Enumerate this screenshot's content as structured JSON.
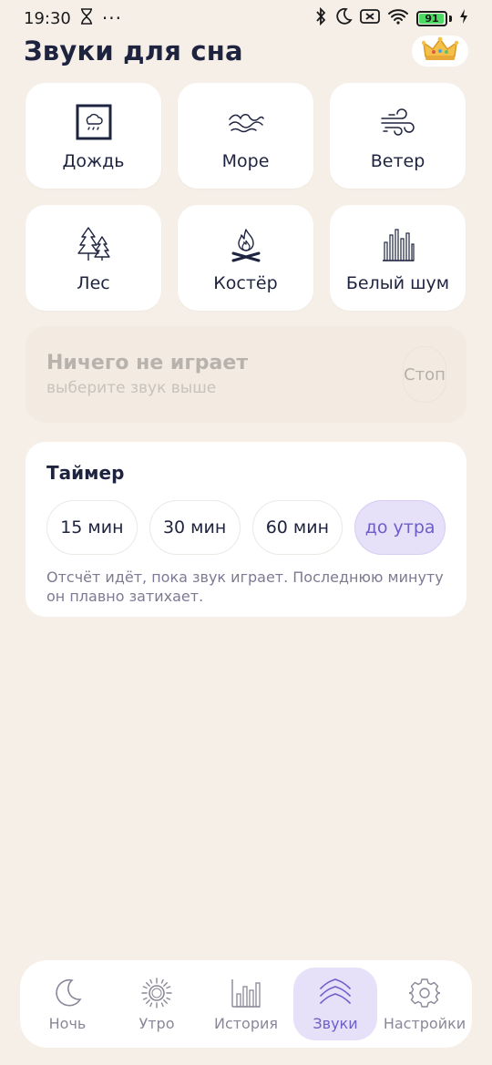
{
  "status_bar": {
    "time": "19:30",
    "dots": "···",
    "battery": "91"
  },
  "header": {
    "title": "Звуки для сна"
  },
  "sounds": [
    {
      "label": "Дождь",
      "icon": "rain-icon"
    },
    {
      "label": "Море",
      "icon": "waves-icon"
    },
    {
      "label": "Ветер",
      "icon": "wind-icon"
    },
    {
      "label": "Лес",
      "icon": "forest-icon"
    },
    {
      "label": "Костёр",
      "icon": "campfire-icon"
    },
    {
      "label": "Белый шум",
      "icon": "white-noise-icon"
    }
  ],
  "player": {
    "title": "Ничего не играет",
    "subtitle": "выберите звук выше",
    "stop_label": "Стоп"
  },
  "timer": {
    "title": "Таймер",
    "options": [
      "15 мин",
      "30 мин",
      "60 мин",
      "до утра"
    ],
    "selected": "до утра",
    "note": "Отсчёт идёт, пока звук играет. Последнюю минуту он плавно затихает."
  },
  "nav": {
    "items": [
      {
        "label": "Ночь",
        "icon": "moon-icon"
      },
      {
        "label": "Утро",
        "icon": "sun-icon"
      },
      {
        "label": "История",
        "icon": "chart-icon"
      },
      {
        "label": "Звуки",
        "icon": "waves-icon"
      },
      {
        "label": "Настройки",
        "icon": "gear-icon"
      }
    ],
    "active": "Звуки"
  },
  "colors": {
    "background": "#f6efe8",
    "card": "#ffffff",
    "accent": "#6d5ec8",
    "accent_bg": "#e6e0f9",
    "text_primary": "#1e2340"
  }
}
